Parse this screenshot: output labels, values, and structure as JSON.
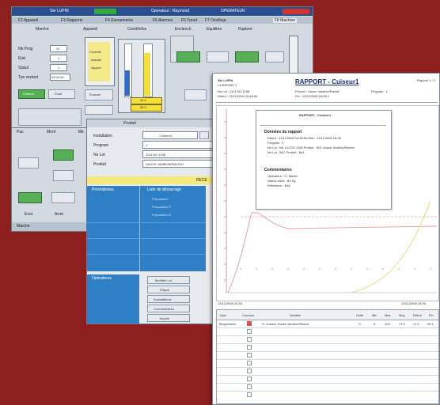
{
  "screen1": {
    "title_left": "Ste LUPIN",
    "title_mid": "Operateur : Raymond",
    "title_right": "OPERATEUR",
    "tabs": [
      "F2 Appareil",
      "F3 Rapports",
      "F4 Evenements",
      "F5 Alarmes",
      "F6 Trend",
      "F7 Oscillogr.",
      "F8 Machine"
    ],
    "cols": [
      "Marche",
      "Appareil",
      "Cond/Infos",
      "Enclench.",
      "Equilibre",
      "Rupture"
    ],
    "fields": [
      {
        "label": "Nb Prog",
        "value": "25"
      },
      {
        "label": "Etat",
        "value": "1"
      },
      {
        "label": "Statut",
        "value": "1"
      },
      {
        "label": "Tps restant",
        "value": "00:00:00"
      }
    ],
    "box_words": [
      "Contrôle",
      "manuel",
      "rapport"
    ],
    "side_btn": "Evacuer",
    "left_btns": [
      "Chaleur",
      "Froid",
      "Auto",
      "Manu"
    ],
    "yellow_values": [
      "34.1",
      "35.3"
    ],
    "bottom_btns": [
      "Evol.",
      "Arret"
    ],
    "status": "Marche"
  },
  "screen2": {
    "header": "Produit",
    "rows": [
      {
        "label": "Installation",
        "value": "Cuiseur1"
      },
      {
        "label": "Program",
        "value": "1"
      },
      {
        "label": "No Lot",
        "value": "1114 DO 1158"
      },
      {
        "label": "Produit",
        "value": "SAUCE JAMBON/RAVIOLI"
      }
    ],
    "yellow_bar": "RECE",
    "col_headers": [
      "Préréalisées",
      "Liste de démarrage"
    ],
    "list_items": [
      "Préparation",
      "Préparation P",
      "Préparation E"
    ],
    "operators_header": "Opérateurs",
    "side_buttons": [
      "Modifier Lot",
      "Etiquet",
      "Exploitations",
      "Commentaires",
      "Imprim"
    ]
  },
  "screen3": {
    "company": "Ste LUPIN",
    "sub": "CUISSONS 1",
    "lot": "No Lot : 1114 DO 1158",
    "start": "Début : 13/11/2008 16:48:56",
    "title": "RAPPORT - Cuiseur1",
    "product_label": "Produit : Sauce Jambon/Ravioli",
    "program_label": "Program : 1",
    "end_label": "Fin : 13/11/2008 18:35:1",
    "page": "Rapport 1 / 1",
    "inner": {
      "title": "RAPPORT - Cuiseur1",
      "section1": "Données du rapport",
      "lines1": [
        "Début : 13/11/2008 16:48:56  Etat : 13/11/2008 18:35",
        "Program : 1",
        "No Lot : Nb 114 DO 1158   Produit : Sb1 Sauce Jambon/Ravioli",
        "No Lot : 58C   Produit : Ba1"
      ],
      "section2": "Commentaires",
      "lines2": [
        "Opérateur : G. Martin",
        "Valeur visée : 80 Kg",
        "Référence : Ba1"
      ]
    },
    "footer_left": "13/11/2008 16:48",
    "footer_right": "13/11/2008 18:35",
    "table_headers": [
      "Nom",
      "Courbes",
      "Variable",
      "Unité",
      "Min",
      "Max",
      "Moy",
      "Début",
      "Fin"
    ],
    "table_row": [
      "Température",
      "",
      "T1 Cuiseur Sauce Jambon/Ravioli",
      "°C",
      "6",
      "103",
      "77.0",
      "17.2",
      "95.1"
    ]
  }
}
